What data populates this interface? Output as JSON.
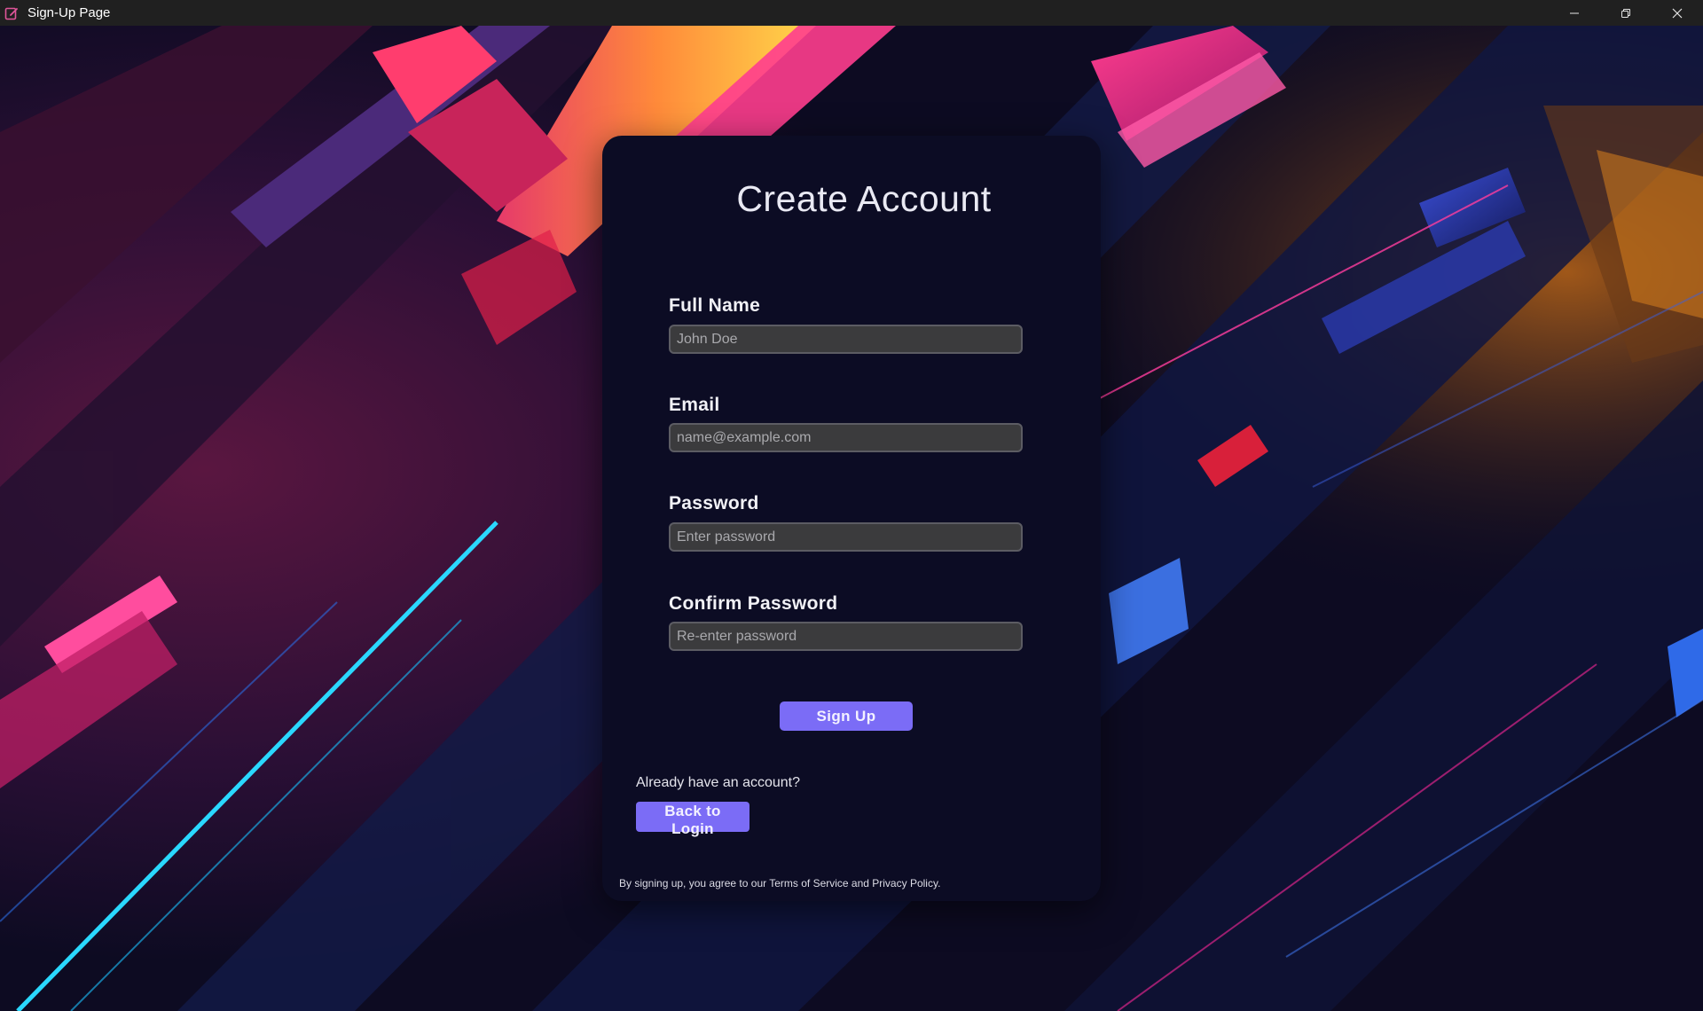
{
  "window": {
    "title": "Sign-Up Page",
    "icon": "edit-note-icon",
    "controls": [
      "minimize-icon",
      "restore-icon",
      "close-icon"
    ]
  },
  "form": {
    "title": "Create Account",
    "fields": [
      {
        "label": "Full Name",
        "placeholder": "John Doe",
        "value": ""
      },
      {
        "label": "Email",
        "placeholder": "name@example.com",
        "value": ""
      },
      {
        "label": "Password",
        "placeholder": "Enter password",
        "value": ""
      },
      {
        "label": "Confirm Password",
        "placeholder": "Re-enter password",
        "value": ""
      }
    ],
    "submit_label": "Sign Up",
    "login_prompt": "Already have an account?",
    "login_button_label": "Back to Login",
    "terms_text": "By signing up, you agree to our Terms of Service and Privacy Policy."
  },
  "colors": {
    "accent": "#7b6cf6",
    "card_background": "#0c0c24",
    "input_background": "#3b3b3d",
    "titlebar": "#202020"
  }
}
